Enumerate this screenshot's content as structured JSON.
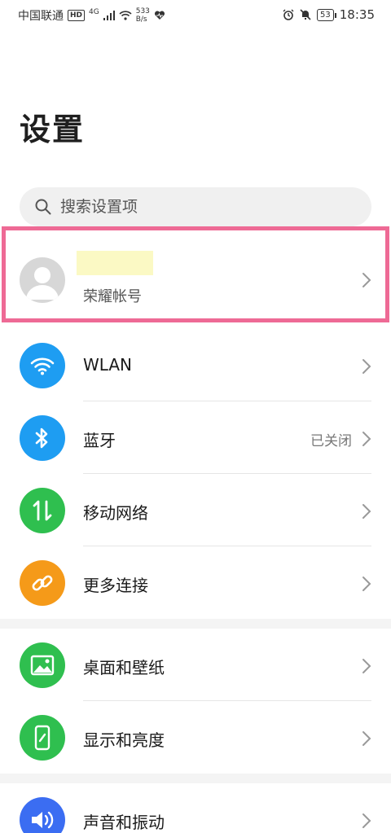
{
  "status_bar": {
    "carrier": "中国联通",
    "hd": "HD",
    "network": "4G",
    "speed_value": "533",
    "speed_unit": "B/s",
    "battery": "53",
    "time": "18:35"
  },
  "page": {
    "title": "设置"
  },
  "search": {
    "placeholder": "搜索设置项"
  },
  "account": {
    "label": "荣耀帐号",
    "highlight_color": "#ee6a95"
  },
  "items": [
    {
      "label": "WLAN",
      "value": "",
      "icon": "wifi-icon",
      "color": "#1e9df2"
    },
    {
      "label": "蓝牙",
      "value": "已关闭",
      "icon": "bluetooth-icon",
      "color": "#1e9df2"
    },
    {
      "label": "移动网络",
      "value": "",
      "icon": "mobile-data-icon",
      "color": "#2fbf4f"
    },
    {
      "label": "更多连接",
      "value": "",
      "icon": "link-icon",
      "color": "#f59a19"
    },
    {
      "label": "桌面和壁纸",
      "value": "",
      "icon": "wallpaper-icon",
      "color": "#2fbf4f"
    },
    {
      "label": "显示和亮度",
      "value": "",
      "icon": "display-icon",
      "color": "#2fbf4f"
    },
    {
      "label": "声音和振动",
      "value": "",
      "icon": "sound-icon",
      "color": "#3b6df2"
    }
  ]
}
